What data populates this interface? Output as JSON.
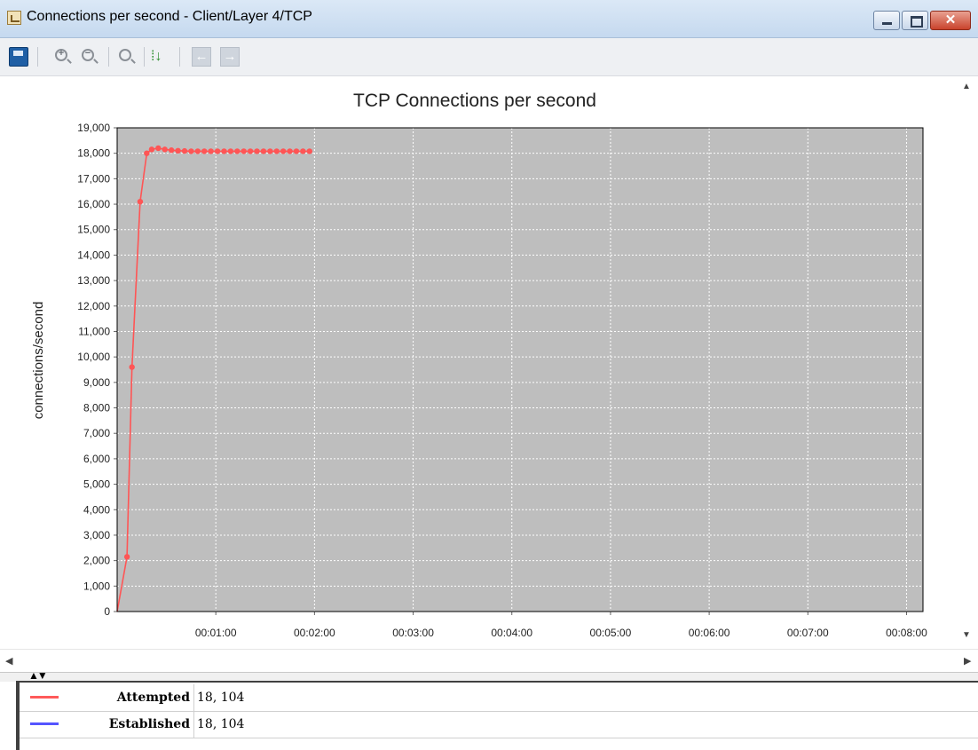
{
  "window": {
    "title": "Connections per second - Client/Layer 4/TCP",
    "close_glyph": "✕"
  },
  "toolbar": {
    "icons": [
      "save-icon",
      "zoom-in-icon",
      "zoom-out-icon",
      "zoom-reset-icon",
      "sort-icon",
      "arrow-left-icon",
      "arrow-right-icon"
    ],
    "zoom_in_glyph": "+",
    "zoom_out_glyph": "−",
    "sort_glyph": "⁞↓",
    "back_glyph": "←",
    "forward_glyph": "→"
  },
  "scroll": {
    "up": "▲",
    "down": "▼",
    "left": "◀",
    "right": "▶"
  },
  "splitter_glyph": "▲▼",
  "chart_data": {
    "type": "line",
    "title": "TCP Connections per second",
    "ylabel": "connections/second",
    "xlabel": "",
    "ylim": [
      0,
      19000
    ],
    "xlim": [
      0,
      490
    ],
    "yticks": [
      "0",
      "1,000",
      "2,000",
      "3,000",
      "4,000",
      "5,000",
      "6,000",
      "7,000",
      "8,000",
      "9,000",
      "10,000",
      "11,000",
      "12,000",
      "13,000",
      "14,000",
      "15,000",
      "16,000",
      "17,000",
      "18,000",
      "19,000"
    ],
    "xticks": [
      {
        "t": 60,
        "label": "00:01:00"
      },
      {
        "t": 120,
        "label": "00:02:00"
      },
      {
        "t": 180,
        "label": "00:03:00"
      },
      {
        "t": 240,
        "label": "00:04:00"
      },
      {
        "t": 300,
        "label": "00:05:00"
      },
      {
        "t": 360,
        "label": "00:06:00"
      },
      {
        "t": 420,
        "label": "00:07:00"
      },
      {
        "t": 480,
        "label": "00:08:00"
      }
    ],
    "grid": true,
    "background": "#bebebe",
    "series": [
      {
        "name": "Attempted",
        "color": "#ff5555",
        "x": [
          0,
          6,
          9,
          14,
          18,
          21,
          25,
          29,
          33,
          37,
          41,
          45,
          49,
          53,
          57,
          61,
          65,
          69,
          73,
          77,
          81,
          85,
          89,
          93,
          97,
          101,
          105,
          109,
          113,
          117
        ],
        "y": [
          0,
          2150,
          9600,
          16100,
          18000,
          18150,
          18200,
          18150,
          18120,
          18100,
          18090,
          18080,
          18080,
          18080,
          18080,
          18080,
          18080,
          18080,
          18080,
          18080,
          18080,
          18080,
          18080,
          18080,
          18080,
          18080,
          18080,
          18080,
          18080,
          18080
        ]
      }
    ]
  },
  "legend": {
    "rows": [
      {
        "name": "Attempted",
        "value": "18, 104",
        "color": "#ff5a5a"
      },
      {
        "name": "Established",
        "value": "18, 104",
        "color": "#5555ff"
      }
    ]
  }
}
